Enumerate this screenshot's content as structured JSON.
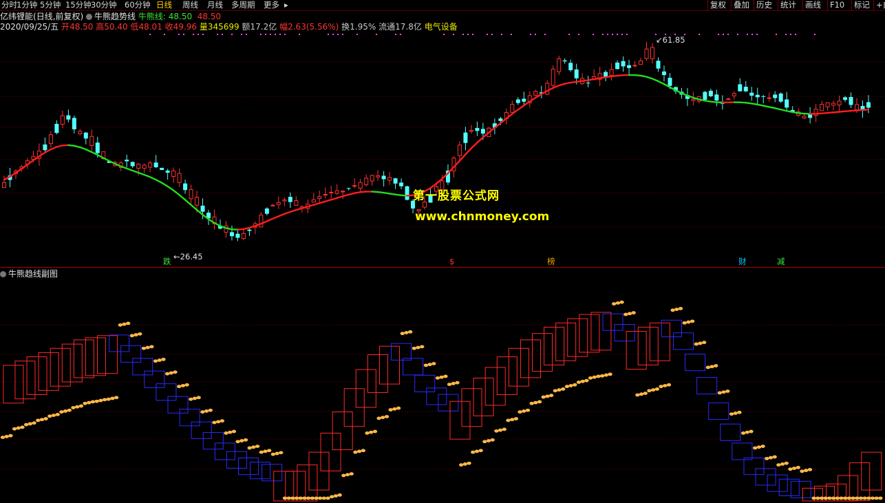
{
  "toolbar": {
    "periods": [
      "分时",
      "1分钟",
      "5分钟",
      "15分钟",
      "30分钟",
      "60分钟",
      "日线",
      "周线",
      "月线",
      "多周期",
      "更多"
    ],
    "active_period": "日线",
    "right_tools": [
      "复权",
      "叠加",
      "历史",
      "统计",
      "画线",
      "F10",
      "标记",
      "+自"
    ]
  },
  "header": {
    "stock_name": "亿纬锂能",
    "mode": "(日线,前复权)",
    "indicator_name": "牛熊趋势线",
    "indicator_line_label": "牛熊线:",
    "indicator_line_value": "48.50",
    "indicator_value2": "48.50"
  },
  "quote": {
    "date": "2020/09/25/五",
    "open_label": "开",
    "open": "48.50",
    "high_label": "高",
    "high": "50.40",
    "low_label": "低",
    "low": "48.01",
    "close_label": "收",
    "close": "49.96",
    "volume_label": "量",
    "volume": "345699",
    "amount_label": "额",
    "amount": "17.2亿",
    "change_label": "幅",
    "change": "2.63(5.56%)",
    "turnover_label": "换",
    "turnover": "1.95%",
    "float_label": "流通",
    "float": "17.8亿",
    "sector": "电气设备"
  },
  "annotations": {
    "high_marker": "61.85",
    "low_marker": "26.45"
  },
  "events": [
    {
      "label": "跌",
      "color": "#39e339"
    },
    {
      "label": "$",
      "color": "#ff3232"
    },
    {
      "label": "榜",
      "color": "#e8a000"
    },
    {
      "label": "财",
      "color": "#00c8ff"
    },
    {
      "label": "减",
      "color": "#39e339"
    }
  ],
  "subchart": {
    "title": "牛熊趋线副图"
  },
  "watermark": {
    "line1": "第一股票公式网",
    "line2": "www.chnmoney.com"
  },
  "colors": {
    "up": "#ff3232",
    "down": "#54ffff",
    "bull_line": "#ff1e1e",
    "bear_line": "#22dd22",
    "bar_red": "#ff2a2a",
    "bar_blue": "#2a2aff",
    "dots": "#ffb84a"
  },
  "chart_data": [
    {
      "type": "candlestick",
      "title": "亿纬锂能 (日线,前复权)",
      "x_dates_visible": [
        "2020/09/25/五"
      ],
      "ylim": [
        22,
        65
      ],
      "annotated_high": 61.85,
      "annotated_low": 26.45,
      "close_path": [
        37.2,
        38.5,
        39.3,
        40.1,
        41.2,
        42.0,
        43.0,
        44.2,
        46.0,
        48.0,
        49.5,
        48.8,
        47.0,
        46.2,
        45.3,
        44.0,
        42.6,
        41.6,
        40.8,
        40.3,
        40.8,
        41.1,
        40.2,
        39.8,
        40.4,
        40.8,
        40.0,
        39.5,
        39.0,
        38.3,
        37.2,
        35.8,
        34.2,
        33.0,
        31.8,
        30.6,
        29.6,
        28.7,
        28.0,
        27.3,
        27.0,
        27.8,
        28.5,
        29.6,
        31.2,
        32.4,
        33.0,
        33.5,
        34.0,
        33.6,
        33.0,
        32.7,
        33.2,
        34.0,
        34.6,
        35.0,
        35.4,
        35.2,
        35.6,
        36.1,
        36.5,
        37.2,
        38.0,
        38.5,
        38.2,
        37.8,
        37.6,
        37.0,
        36.5,
        34.0,
        32.4,
        32.2,
        33.6,
        35.0,
        36.4,
        37.5,
        39.4,
        41.7,
        44.1,
        46.4,
        46.8,
        46.7,
        46.2,
        47.2,
        48.1,
        49.0,
        50.1,
        51.6,
        52.5,
        52.1,
        53.2,
        54.0,
        53.6,
        55.5,
        58.1,
        60.0,
        59.7,
        57.9,
        56.4,
        55.4,
        55.6,
        56.7,
        57.3,
        56.6,
        58.0,
        59.3,
        58.6,
        58.3,
        58.8,
        59.6,
        61.8,
        60.0,
        58.2,
        57.0,
        55.0,
        54.0,
        53.4,
        52.6,
        52.3,
        53.0,
        53.9,
        53.1,
        52.3,
        52.0,
        52.6,
        53.6,
        55.3,
        54.0,
        53.2,
        52.9,
        53.1,
        52.8,
        53.4,
        52.1,
        51.0,
        50.2,
        49.6,
        49.4,
        49.1,
        50.7,
        51.6,
        51.9,
        51.8,
        52.2,
        52.9,
        51.5,
        50.6,
        51.3,
        52.0
      ],
      "series": [
        {
          "name": "牛熊线",
          "last_value": 48.5
        }
      ]
    },
    {
      "type": "bar",
      "title": "牛熊趋线副图",
      "note": "stacked hollow step bars with dotted trend bands; normalized 0-1 oscillation",
      "band_level": [
        0.6,
        0.64,
        0.66,
        0.68,
        0.7,
        0.72,
        0.74,
        0.76,
        0.77,
        0.78,
        0.75,
        0.7,
        0.64,
        0.58,
        0.52,
        0.46,
        0.4,
        0.34,
        0.29,
        0.24,
        0.2,
        0.17,
        0.15,
        0.14,
        0.14,
        0.14,
        0.17,
        0.23,
        0.32,
        0.42,
        0.53,
        0.62,
        0.69,
        0.73,
        0.71,
        0.64,
        0.56,
        0.5,
        0.47,
        0.47,
        0.53,
        0.58,
        0.63,
        0.68,
        0.72,
        0.76,
        0.79,
        0.82,
        0.84,
        0.86,
        0.88,
        0.89,
        0.85,
        0.8,
        0.8,
        0.82,
        0.84,
        0.82,
        0.76,
        0.66,
        0.55,
        0.43,
        0.33,
        0.24,
        0.17,
        0.12,
        0.09,
        0.07,
        0.06,
        0.06,
        0.07,
        0.08,
        0.12,
        0.18,
        0.23
      ]
    }
  ]
}
